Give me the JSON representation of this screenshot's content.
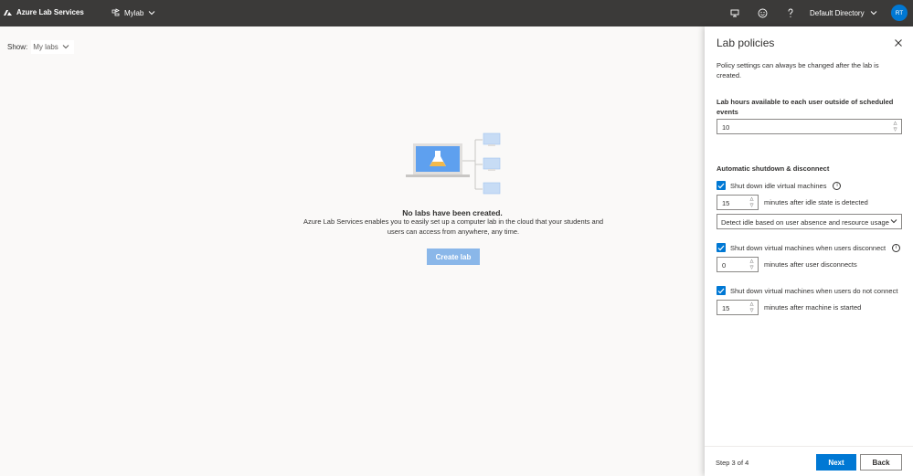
{
  "header": {
    "app_name": "Azure Lab Services",
    "lab_picker": "Mylab",
    "directory": "Default Directory",
    "avatar_initials": "RT",
    "icons": [
      "azure-logo-icon",
      "lab-picker-icon",
      "monitor-icon",
      "smiley-icon",
      "help-icon",
      "chevron-down-icon"
    ]
  },
  "main": {
    "show_label": "Show:",
    "show_value": "My labs",
    "empty_title": "No labs have been created.",
    "empty_text": "Azure Lab Services enables you to easily set up a computer lab in the cloud that your students and users can access from anywhere, any time.",
    "create_button": "Create lab"
  },
  "panel": {
    "title": "Lab policies",
    "description": "Policy settings can always be changed after the lab is created.",
    "lab_hours_label": "Lab hours available to each user outside of scheduled events",
    "lab_hours_value": "10",
    "section_title": "Automatic shutdown & disconnect",
    "idle": {
      "label": "Shut down idle virtual machines",
      "checked": true,
      "minutes": "15",
      "after_text": "minutes after idle state is detected",
      "detect_option": "Detect idle based on user absence and resource usage"
    },
    "disconnect": {
      "label": "Shut down virtual machines when users disconnect",
      "checked": true,
      "minutes": "0",
      "after_text": "minutes after user disconnects"
    },
    "no_connect": {
      "label": "Shut down virtual machines when users do not connect",
      "checked": true,
      "minutes": "15",
      "after_text": "minutes after machine is started"
    },
    "footer": {
      "step": "Step 3 of 4",
      "next": "Next",
      "back": "Back"
    }
  },
  "colors": {
    "topbar": "#3b3a39",
    "accent": "#0078d4",
    "disabled_button": "#8ab7e9"
  }
}
